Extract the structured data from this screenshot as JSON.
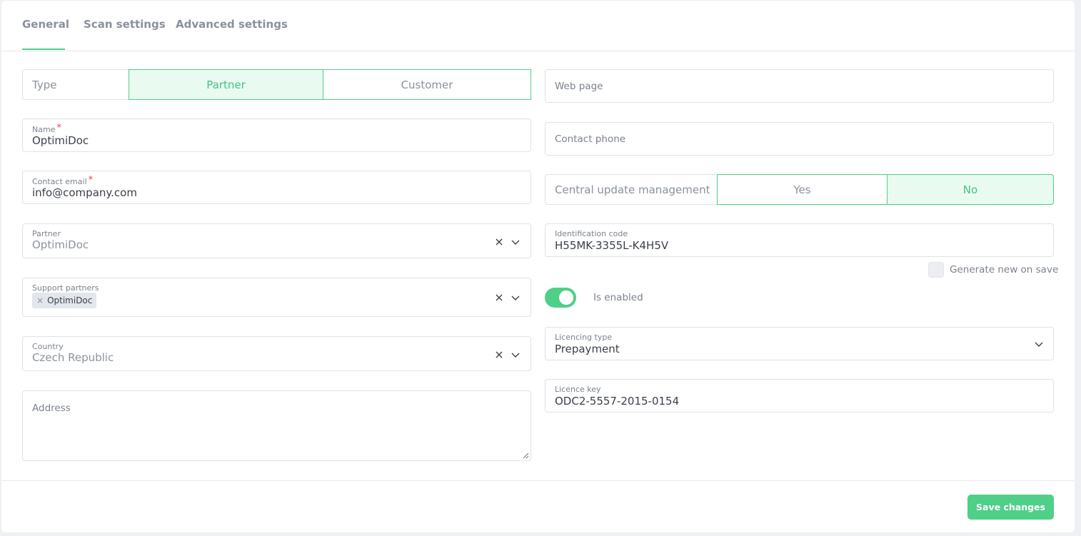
{
  "tabs": [
    {
      "label": "General",
      "active": true
    },
    {
      "label": "Scan settings",
      "active": false
    },
    {
      "label": "Advanced settings",
      "active": false
    }
  ],
  "left": {
    "type": {
      "label": "Type",
      "options": [
        "Partner",
        "Customer"
      ],
      "selected": "Partner"
    },
    "name": {
      "label": "Name",
      "required_mark": "*",
      "value": "OptimiDoc"
    },
    "contact_email": {
      "label": "Contact email",
      "required_mark": "*",
      "value": "info@company.com"
    },
    "partner": {
      "label": "Partner",
      "value": "OptimiDoc"
    },
    "support_partners": {
      "label": "Support partners",
      "chips": [
        "OptimiDoc"
      ],
      "chip_remove": "×"
    },
    "country": {
      "label": "Country",
      "value": "Czech Republic"
    },
    "address": {
      "placeholder": "Address"
    }
  },
  "right": {
    "web_page": {
      "placeholder": "Web page"
    },
    "contact_phone": {
      "placeholder": "Contact phone"
    },
    "central_update": {
      "label": "Central update management",
      "options": [
        "Yes",
        "No"
      ],
      "selected": "No"
    },
    "identification_code": {
      "label": "Identification code",
      "value": "H55MK-3355L-K4H5V"
    },
    "generate_new": {
      "label": "Generate new on save",
      "checked": false
    },
    "is_enabled": {
      "label": "Is enabled",
      "on": true
    },
    "licencing_type": {
      "label": "Licencing type",
      "value": "Prepayment"
    },
    "licence_key": {
      "label": "Licence key",
      "value": "ODC2-5557-2015-0154"
    }
  },
  "footer": {
    "save_label": "Save changes"
  },
  "colors": {
    "accent": "#4fcf88",
    "accent_bg": "#e9fbf1",
    "required": "#e5484d"
  },
  "icons": [
    "clear-icon",
    "chevron-down-icon",
    "resize-grip-icon"
  ]
}
